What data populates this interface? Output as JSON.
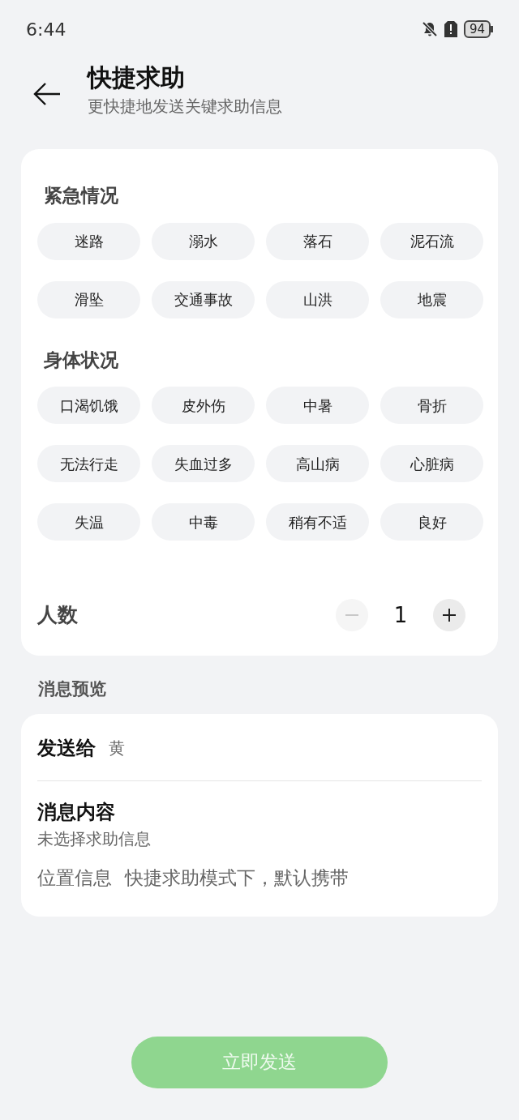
{
  "status_bar": {
    "time": "6:44",
    "battery": "94"
  },
  "header": {
    "title": "快捷求助",
    "subtitle": "更快捷地发送关键求助信息"
  },
  "sections": [
    {
      "title": "紧急情况",
      "chips": [
        {
          "label": "迷路",
          "selected": false
        },
        {
          "label": "溺水",
          "selected": false
        },
        {
          "label": "落石",
          "selected": false
        },
        {
          "label": "泥石流",
          "selected": false
        },
        {
          "label": "滑坠",
          "selected": false
        },
        {
          "label": "交通事故",
          "selected": false
        },
        {
          "label": "山洪",
          "selected": false
        },
        {
          "label": "地震",
          "selected": false
        }
      ]
    },
    {
      "title": "身体状况",
      "chips": [
        {
          "label": "口渴饥饿",
          "selected": false
        },
        {
          "label": "皮外伤",
          "selected": false
        },
        {
          "label": "中暑",
          "selected": false
        },
        {
          "label": "骨折",
          "selected": false
        },
        {
          "label": "无法行走",
          "selected": false
        },
        {
          "label": "失血过多",
          "selected": false
        },
        {
          "label": "高山病",
          "selected": false
        },
        {
          "label": "心脏病",
          "selected": false
        },
        {
          "label": "失温",
          "selected": false
        },
        {
          "label": "中毒",
          "selected": false
        },
        {
          "label": "稍有不适",
          "selected": false
        },
        {
          "label": "良好",
          "selected": false
        }
      ]
    }
  ],
  "people": {
    "label": "人数",
    "value": "1",
    "minus": {
      "disabled": true
    },
    "plus": {
      "disabled": false
    }
  },
  "preview": {
    "heading": "消息预览",
    "recipient_label": "发送给",
    "recipient": "黄",
    "content_label": "消息内容",
    "content": "未选择求助信息",
    "location_label": "位置信息",
    "location_note": "快捷求助模式下，默认携带"
  },
  "send_button": {
    "label": "立即发送",
    "disabled": true
  }
}
